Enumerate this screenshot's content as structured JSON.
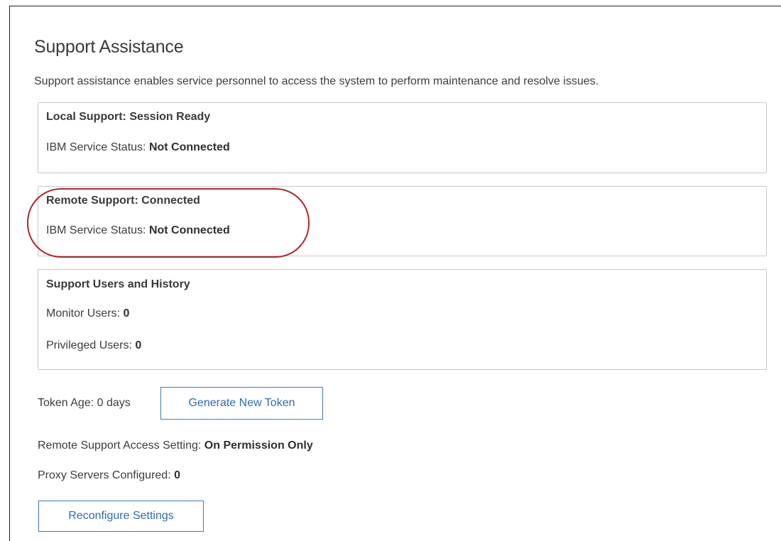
{
  "page": {
    "title": "Support Assistance",
    "intro": "Support assistance enables service personnel to access the system to perform maintenance and resolve issues."
  },
  "local_support": {
    "heading": "Local Support: Session Ready",
    "status_label": "IBM Service Status: ",
    "status_value": "Not Connected"
  },
  "remote_support": {
    "heading": "Remote Support: Connected",
    "status_label": "IBM Service Status: ",
    "status_value": "Not Connected"
  },
  "users_history": {
    "heading": "Support Users and History",
    "monitor_label": "Monitor Users: ",
    "monitor_value": "0",
    "privileged_label": "Privileged Users: ",
    "privileged_value": "0"
  },
  "token": {
    "age_text": "Token Age: 0 days",
    "generate_button": "Generate New Token"
  },
  "settings": {
    "access_label": "Remote Support Access Setting: ",
    "access_value": "On Permission Only",
    "proxy_label": "Proxy Servers Configured: ",
    "proxy_value": "0",
    "reconfigure_button": "Reconfigure Settings"
  },
  "colors": {
    "annotation_ring": "#b0282a",
    "button_border": "#4178be",
    "button_text": "#2d6cb5",
    "panel_border": "#c8c8c8"
  }
}
